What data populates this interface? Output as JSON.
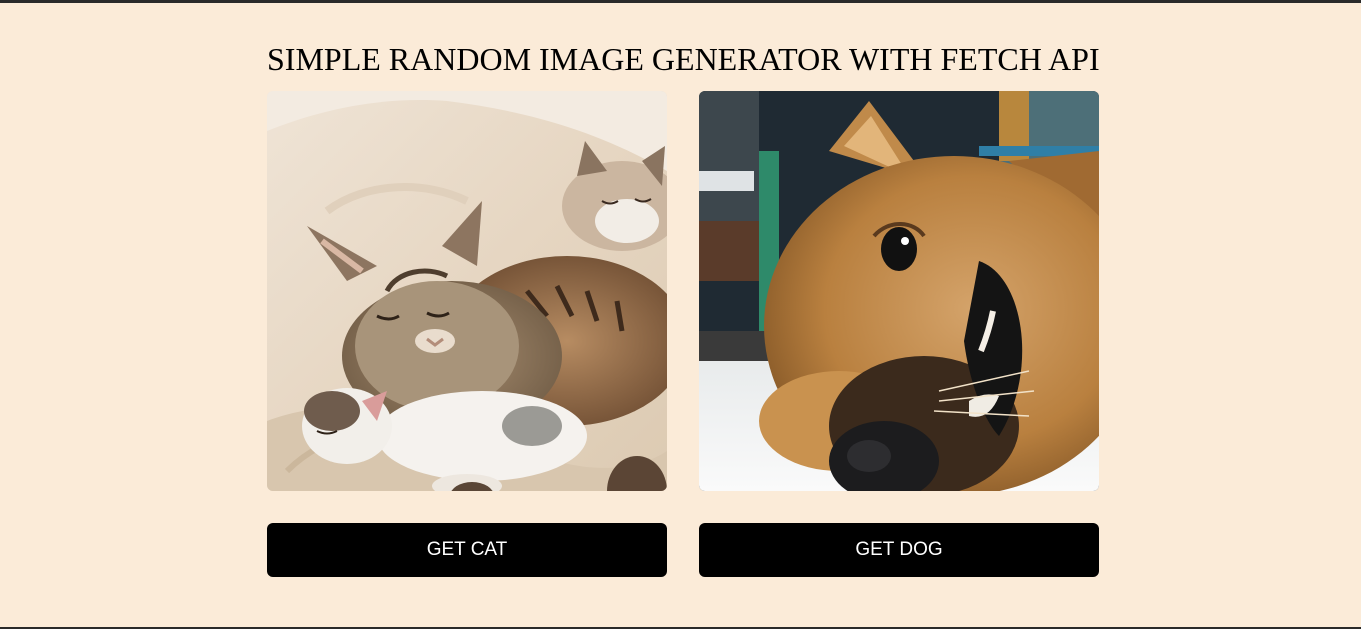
{
  "page": {
    "title": "SIMPLE RANDOM IMAGE GENERATOR WITH FETCH API"
  },
  "cards": {
    "cat": {
      "image_subject": "cat-image",
      "button_label": "GET CAT"
    },
    "dog": {
      "image_subject": "dog-image",
      "button_label": "GET DOG"
    }
  },
  "colors": {
    "background": "#fbebd8",
    "button": "#000000",
    "button_text": "#ffffff"
  }
}
